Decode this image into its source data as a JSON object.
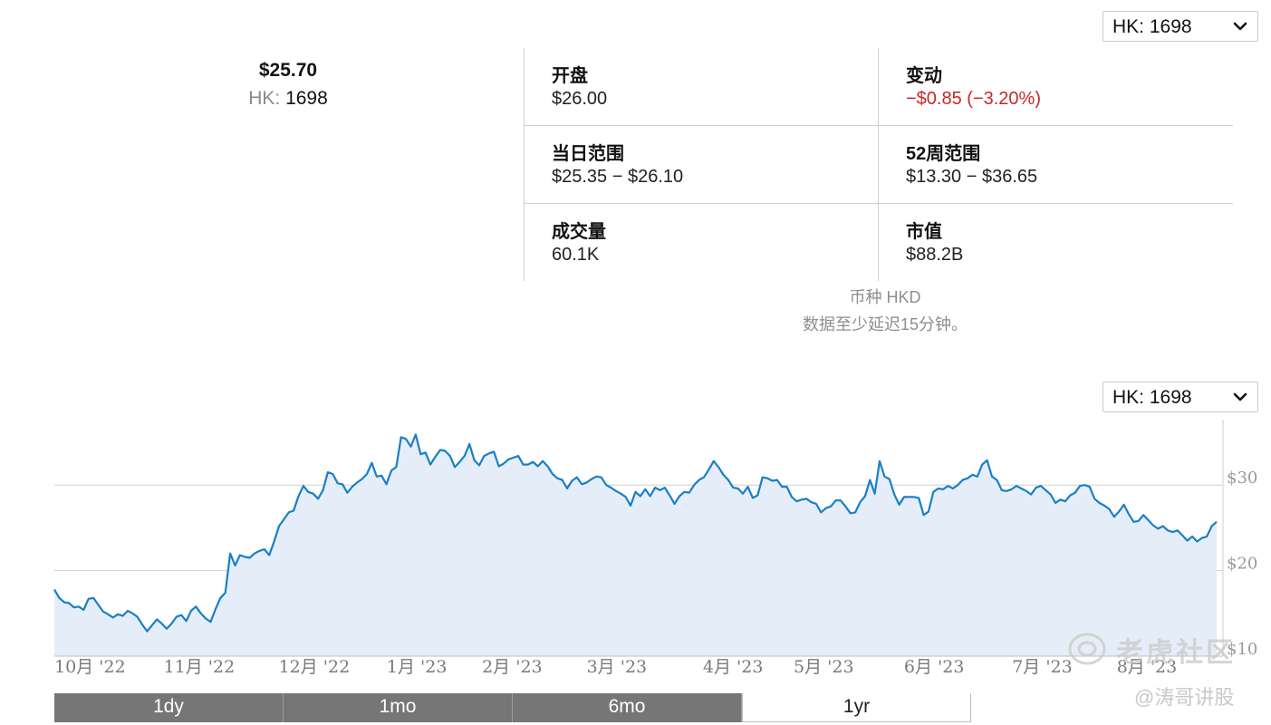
{
  "header": {
    "price": "$25.70",
    "exchange_prefix": "HK:",
    "ticker": "1698",
    "select_top": "HK: 1698"
  },
  "stats": [
    {
      "label": "开盘",
      "value": "$26.00"
    },
    {
      "label": "变动",
      "value": "−$0.85 (−3.20%)"
    },
    {
      "label": "当日范围",
      "value": "$25.35 − $26.10"
    },
    {
      "label": "52周范围",
      "value": "$13.30 − $36.65"
    },
    {
      "label": "成交量",
      "value": "60.1K"
    },
    {
      "label": "市值",
      "value": "$88.2B"
    }
  ],
  "notes": {
    "currency": "币种 HKD",
    "delay": "数据至少延迟15分钟。"
  },
  "chart_select": "HK: 1698",
  "tabs": [
    {
      "label": "1dy",
      "active": false
    },
    {
      "label": "1mo",
      "active": false
    },
    {
      "label": "6mo",
      "active": false
    },
    {
      "label": "1yr",
      "active": true
    }
  ],
  "watermark": {
    "logo_text": "老虎社区",
    "handle": "@涛哥讲股"
  },
  "colors": {
    "line": "#1a7fc6",
    "area": "#e5eef8",
    "negative": "#c62828"
  },
  "icons": {
    "select_chevron": "chevron-down-icon"
  },
  "chart_data": {
    "type": "area",
    "x_tick_labels": [
      "10月 '22",
      "11月 '22",
      "12月 '22",
      "1月 '23",
      "2月 '23",
      "3月 '23",
      "4月 '23",
      "5月 '23",
      "6月 '23",
      "7月 '23",
      "8月 '23"
    ],
    "y_tick_labels": [
      "$30",
      "$20",
      "$10"
    ],
    "y_ticks": [
      30,
      20,
      10
    ],
    "ylim": [
      10,
      38.5
    ],
    "grid": true,
    "series": [
      {
        "values": [
          17.8,
          16.8,
          16.3,
          16.2,
          15.7,
          15.8,
          15.4,
          16.7,
          16.8,
          16.0,
          15.2,
          14.9,
          14.5,
          14.9,
          14.7,
          15.3,
          15.0,
          14.6,
          13.7,
          12.9,
          13.6,
          14.3,
          13.8,
          13.2,
          13.8,
          14.6,
          14.8,
          14.1,
          15.3,
          15.8,
          15.0,
          14.4,
          14.0,
          15.5,
          16.8,
          17.4,
          22.0,
          20.6,
          21.8,
          21.6,
          21.5,
          22.0,
          22.3,
          22.5,
          21.8,
          23.4,
          25.2,
          26.0,
          26.8,
          27.0,
          28.7,
          29.9,
          29.2,
          29.0,
          28.4,
          29.4,
          31.5,
          31.3,
          30.2,
          30.1,
          29.1,
          29.8,
          30.3,
          30.7,
          31.3,
          32.6,
          31.0,
          31.1,
          30.1,
          31.7,
          32.1,
          35.6,
          35.4,
          34.5,
          35.9,
          33.6,
          33.8,
          32.4,
          33.3,
          34.1,
          34.0,
          33.4,
          32.1,
          32.7,
          33.4,
          34.8,
          32.9,
          32.3,
          33.4,
          33.7,
          33.9,
          32.2,
          32.5,
          33.0,
          33.2,
          33.4,
          32.4,
          32.4,
          32.7,
          32.2,
          32.8,
          32.2,
          31.3,
          30.8,
          30.6,
          29.6,
          30.5,
          30.9,
          30.1,
          30.3,
          30.7,
          31.0,
          30.9,
          30.0,
          29.7,
          29.3,
          29.0,
          28.6,
          27.6,
          29.2,
          28.7,
          29.5,
          28.7,
          29.7,
          29.4,
          29.7,
          28.8,
          27.8,
          28.7,
          29.2,
          29.1,
          30.0,
          30.6,
          30.9,
          31.8,
          32.8,
          32.1,
          31.2,
          30.6,
          29.7,
          29.6,
          29.0,
          29.8,
          28.5,
          28.8,
          30.9,
          30.8,
          30.5,
          30.6,
          29.8,
          29.8,
          28.6,
          28.1,
          28.3,
          28.4,
          28.0,
          27.8,
          26.8,
          27.3,
          27.5,
          28.2,
          28.2,
          27.5,
          26.7,
          26.8,
          28.0,
          28.7,
          30.6,
          29.0,
          32.8,
          31.0,
          30.7,
          28.9,
          27.7,
          28.6,
          28.6,
          28.6,
          28.5,
          26.5,
          26.9,
          29.2,
          29.6,
          29.5,
          29.9,
          29.6,
          30.0,
          30.6,
          30.8,
          31.2,
          31.0,
          32.4,
          32.9,
          31.0,
          30.6,
          29.4,
          29.3,
          29.5,
          29.9,
          29.6,
          29.3,
          28.9,
          29.7,
          29.9,
          29.4,
          28.9,
          27.9,
          28.3,
          28.1,
          28.8,
          29.1,
          29.9,
          30.0,
          29.8,
          28.4,
          27.9,
          27.6,
          27.2,
          26.3,
          26.9,
          27.7,
          26.6,
          25.7,
          25.8,
          26.5,
          25.9,
          25.3,
          24.9,
          25.2,
          24.7,
          24.5,
          24.7,
          24.1,
          23.5,
          24.0,
          23.4,
          23.8,
          24.0,
          25.2,
          25.7
        ]
      }
    ]
  }
}
